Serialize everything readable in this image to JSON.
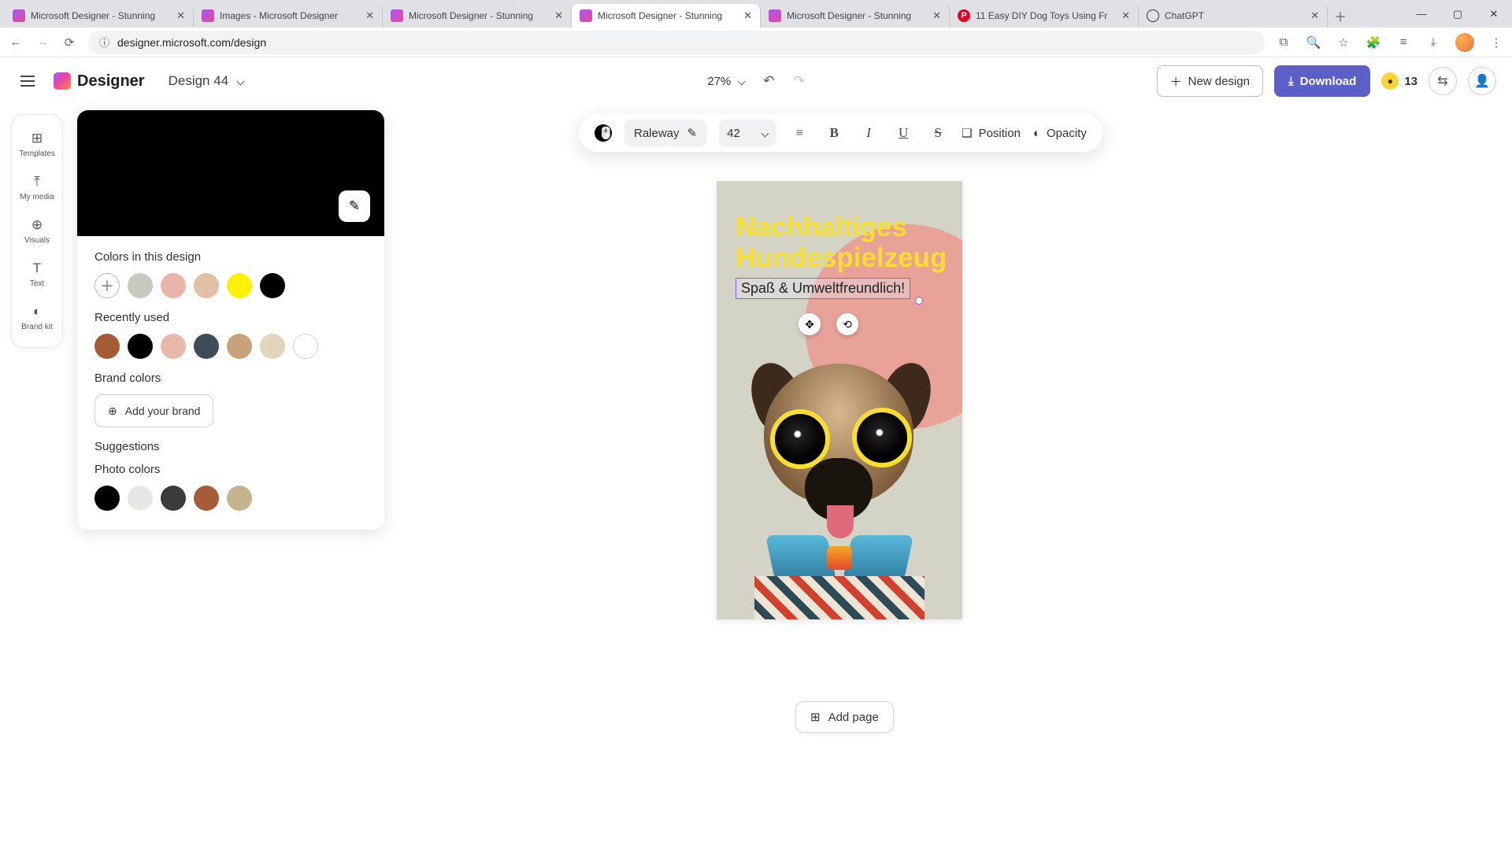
{
  "browser": {
    "tabs": [
      {
        "title": "Microsoft Designer - Stunning",
        "favicon": "designer"
      },
      {
        "title": "Images - Microsoft Designer",
        "favicon": "designer"
      },
      {
        "title": "Microsoft Designer - Stunning",
        "favicon": "designer"
      },
      {
        "title": "Microsoft Designer - Stunning",
        "favicon": "designer",
        "active": true
      },
      {
        "title": "Microsoft Designer - Stunning",
        "favicon": "designer"
      },
      {
        "title": "11 Easy DIY Dog Toys Using Fr",
        "favicon": "pinterest"
      },
      {
        "title": "ChatGPT",
        "favicon": "chatgpt"
      }
    ],
    "url": "designer.microsoft.com/design"
  },
  "header": {
    "brand": "Designer",
    "design_name": "Design 44",
    "zoom": "27%",
    "new_design": "New design",
    "download": "Download",
    "credits": "13"
  },
  "rail": {
    "items": [
      {
        "icon": "⊞",
        "label": "Templates"
      },
      {
        "icon": "⤒",
        "label": "My media"
      },
      {
        "icon": "⊕",
        "label": "Visuals"
      },
      {
        "icon": "T",
        "label": "Text"
      },
      {
        "icon": "◐",
        "label": "Brand kit"
      }
    ]
  },
  "panel": {
    "sections": {
      "design_colors": {
        "title": "Colors in this design",
        "swatches": [
          "#c8c9be",
          "#e9b5aa",
          "#e0bfa4",
          "#fff200",
          "#000000"
        ]
      },
      "recent": {
        "title": "Recently used",
        "swatches": [
          "#a65c36",
          "#000000",
          "#e8b8a8",
          "#3e4c59",
          "#c8a27b",
          "#e3d5bb",
          "#ffffff"
        ]
      },
      "brand": {
        "title": "Brand colors",
        "button": "Add your brand"
      },
      "suggestions": {
        "title": "Suggestions"
      },
      "photo": {
        "title": "Photo colors",
        "swatches": [
          "#000000",
          "#e7e7e4",
          "#3b3b39",
          "#a65c36",
          "#c5b58e"
        ]
      }
    }
  },
  "toolbar": {
    "color": "#000000",
    "font": "Raleway",
    "size": "42",
    "position_label": "Position",
    "opacity_label": "Opacity"
  },
  "canvas": {
    "headline_line1": "Nachhaltiges",
    "headline_line2": "Hundespielzeug",
    "subline": "Spaß & Umweltfreundlich!"
  },
  "footer": {
    "add_page": "Add page"
  }
}
